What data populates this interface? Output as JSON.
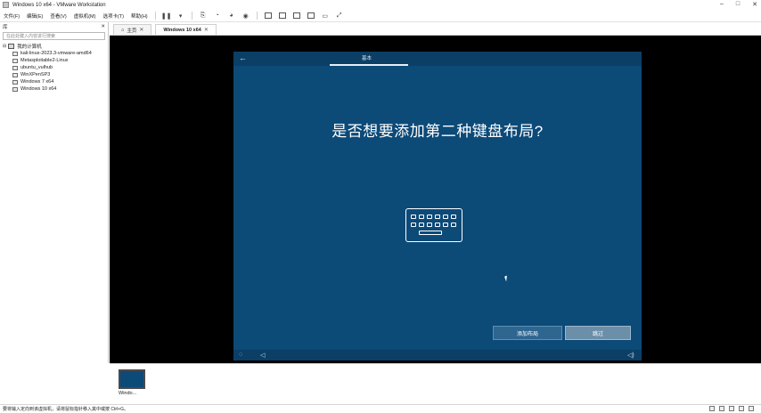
{
  "window": {
    "title": "Windows 10 x64 - VMware Workstation"
  },
  "menu": {
    "items": [
      "文件(F)",
      "编辑(E)",
      "查看(V)",
      "虚拟机(M)",
      "选项卡(T)",
      "帮助(H)"
    ]
  },
  "sidebar": {
    "header": "库",
    "search_placeholder": "在此处键入内容进行搜索",
    "root": "我的计算机",
    "items": [
      "kali-linux-2023.3-vmware-amd64",
      "Metasploitable2-Linux",
      "ubuntu_vulhub",
      "WinXPenSP3",
      "Windows 7 x64",
      "Windows 10 x64"
    ]
  },
  "tabs": [
    {
      "label": "主页"
    },
    {
      "label": "Windows 10 x64",
      "active": true
    }
  ],
  "guest": {
    "progress_label": "基本",
    "heading": "是否想要添加第二种键盘布局?",
    "add_layout_button": "添加布局",
    "skip_button": "跳过"
  },
  "thumbnails": [
    {
      "label": "Windo..."
    }
  ],
  "statusbar": {
    "text": "要将输入定向到该虚拟机，请将鼠标指针移入其中或按 Ctrl+G。"
  },
  "colors": {
    "guest_bg": "#0c4a78",
    "vm_bg": "#000000"
  }
}
